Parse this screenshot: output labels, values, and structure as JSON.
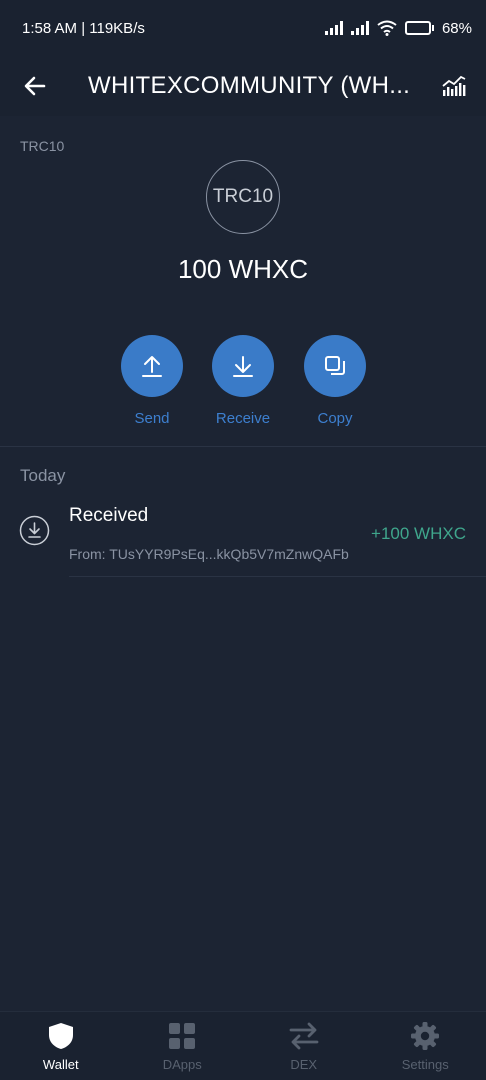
{
  "status_bar": {
    "time_speed": "1:58 AM | 119KB/s",
    "battery": "68"
  },
  "header": {
    "title": "WHITEXCOMMUNITY (WH..."
  },
  "token": {
    "type_label": "TRC10",
    "logo_text": "TRC10",
    "balance": "100 WHXC"
  },
  "actions": [
    {
      "label": "Send",
      "icon": "upload-arrow-icon"
    },
    {
      "label": "Receive",
      "icon": "download-arrow-icon"
    },
    {
      "label": "Copy",
      "icon": "copy-icon"
    }
  ],
  "history": {
    "section": "Today",
    "transactions": [
      {
        "title": "Received",
        "from": "From: TUsYYR9PsEq...kkQb5V7mZnwQAFb",
        "amount": "+100 WHXC",
        "icon": "received-icon"
      }
    ]
  },
  "tabs": [
    {
      "label": "Wallet",
      "icon": "shield-icon",
      "active": true
    },
    {
      "label": "DApps",
      "icon": "grid-icon",
      "active": false
    },
    {
      "label": "DEX",
      "icon": "swap-arrows-icon",
      "active": false
    },
    {
      "label": "Settings",
      "icon": "gear-icon",
      "active": false
    }
  ],
  "colors": {
    "background": "#1c2433",
    "accent": "#3a7bc8",
    "positive": "#3fa68c",
    "muted": "#8a93a3"
  }
}
